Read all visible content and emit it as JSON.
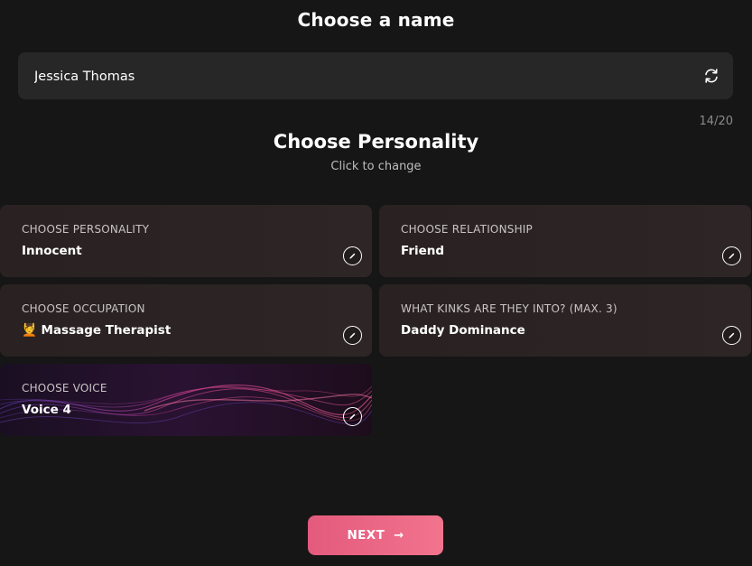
{
  "header": {
    "title": "Choose a name"
  },
  "name_field": {
    "value": "Jessica Thomas",
    "icon": "refresh-icon",
    "counter": "14/20"
  },
  "personality_section": {
    "title": "Choose Personality",
    "subtitle": "Click to change"
  },
  "cards": {
    "personality": {
      "label": "CHOOSE PERSONALITY",
      "value": "Innocent",
      "icon": "edit-icon"
    },
    "relationship": {
      "label": "CHOOSE RELATIONSHIP",
      "value": "Friend",
      "icon": "edit-icon"
    },
    "occupation": {
      "label": "CHOOSE OCCUPATION",
      "emoji": "💆",
      "value": "Massage Therapist",
      "icon": "edit-icon"
    },
    "kinks": {
      "label": "WHAT KINKS ARE THEY INTO? (MAX. 3)",
      "value": "Daddy Dominance",
      "icon": "edit-icon"
    },
    "voice": {
      "label": "CHOOSE VOICE",
      "value": "Voice 4",
      "icon": "edit-icon"
    }
  },
  "next_button": {
    "label": "NEXT",
    "icon": "arrow-right-icon"
  },
  "colors": {
    "background": "#161616",
    "input_bg": "#272727",
    "card_bg": "#2a2222",
    "accent_start": "#e35a7d",
    "accent_end": "#f2748d"
  }
}
